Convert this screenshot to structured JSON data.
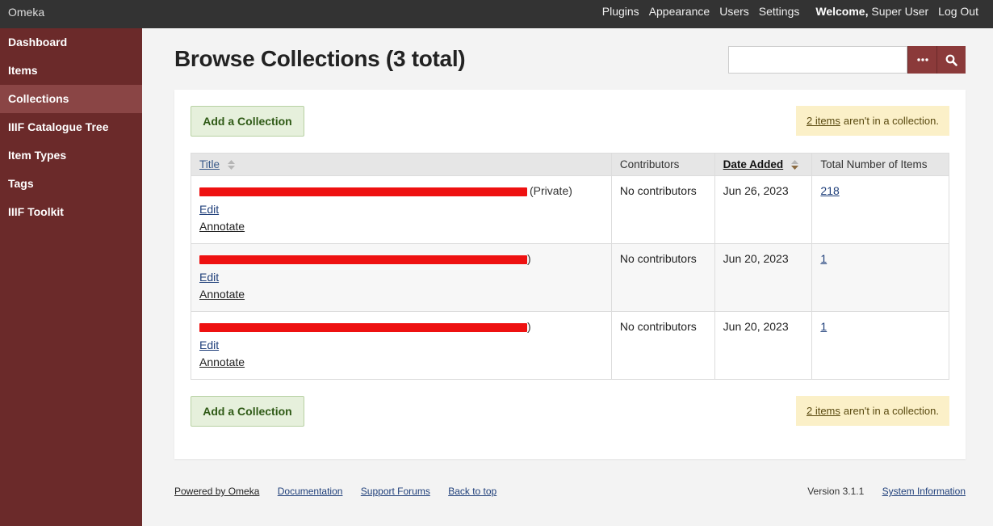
{
  "topbar": {
    "site_title": "Omeka",
    "nav": [
      "Plugins",
      "Appearance",
      "Users",
      "Settings"
    ],
    "welcome_label": "Welcome,",
    "user_name": "Super User",
    "logout": "Log Out"
  },
  "sidebar": {
    "items": [
      {
        "label": "Dashboard"
      },
      {
        "label": "Items"
      },
      {
        "label": "Collections"
      },
      {
        "label": "IIIF Catalogue Tree"
      },
      {
        "label": "Item Types"
      },
      {
        "label": "Tags"
      },
      {
        "label": "IIIF Toolkit"
      }
    ],
    "active": "Collections"
  },
  "page": {
    "title": "Browse Collections (3 total)",
    "search_placeholder": "",
    "search_options_icon": "ellipsis-icon",
    "search_submit_icon": "search-icon"
  },
  "actions": {
    "add_collection": "Add a Collection",
    "notice_link": "2 items",
    "notice_text": "aren't in a collection."
  },
  "table": {
    "headers": {
      "title": "Title",
      "contributors": "Contributors",
      "date_added": "Date Added",
      "total_items": "Total Number of Items"
    },
    "rows": [
      {
        "status": "(Private)",
        "edit": "Edit",
        "annotate": "Annotate",
        "contributors": "No contributors",
        "date_added": "Jun 26, 2023",
        "total_items": "218"
      },
      {
        "status": ")",
        "edit": "Edit",
        "annotate": "Annotate",
        "contributors": "No contributors",
        "date_added": "Jun 20, 2023",
        "total_items": "1"
      },
      {
        "status": ")",
        "edit": "Edit",
        "annotate": "Annotate",
        "contributors": "No contributors",
        "date_added": "Jun 20, 2023",
        "total_items": "1"
      }
    ]
  },
  "footer": {
    "powered_by": "Powered by Omeka",
    "documentation": "Documentation",
    "support_forums": "Support Forums",
    "back_to_top": "Back to top",
    "version": "Version 3.1.1",
    "system_information": "System Information"
  },
  "colors": {
    "topbar": "#333333",
    "sidebar": "#6b2a2a",
    "sidebar_active": "#8a4545",
    "accent_button": "#8b3a3a",
    "add_button_bg": "#e6f0dc",
    "notice_bg": "#fbf0c8",
    "redaction": "#ee1111"
  }
}
